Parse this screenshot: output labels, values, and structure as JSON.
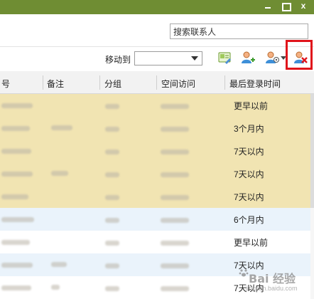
{
  "window": {
    "minimize_icon": "minimize-icon",
    "maximize_icon": "maximize-icon",
    "close_label": "x",
    "titlebar_color": "#6f8d33"
  },
  "search": {
    "placeholder": "搜索联系人",
    "value": "搜索联系人"
  },
  "toolbar": {
    "move_to_label": "移动到",
    "move_to_value": "",
    "tools": [
      "contact-card-icon",
      "add-friend-icon",
      "manage-friends-icon",
      "delete-friend-icon"
    ],
    "highlight_color": "#e0141b"
  },
  "table": {
    "columns": [
      "号",
      "备注",
      "分组",
      "空间访问",
      "最后登录时间"
    ],
    "rows": [
      {
        "style": "yellow",
        "last_login": "更早以前"
      },
      {
        "style": "yellow",
        "last_login": "3个月内"
      },
      {
        "style": "yellow",
        "last_login": "7天以内"
      },
      {
        "style": "yellow",
        "last_login": "7天以内"
      },
      {
        "style": "yellow",
        "last_login": "7天以内"
      },
      {
        "style": "blue",
        "last_login": "6个月内"
      },
      {
        "style": "white",
        "last_login": "更早以前"
      },
      {
        "style": "blue",
        "last_login": "7天以内"
      },
      {
        "style": "white",
        "last_login": "7天以内"
      }
    ],
    "row_colors": {
      "yellow": "#f1e4b2",
      "blue": "#eaf3fb",
      "white": "#ffffff"
    }
  },
  "watermark": {
    "text": "Bai 经验",
    "sub": "jingyan.baidu.com"
  }
}
